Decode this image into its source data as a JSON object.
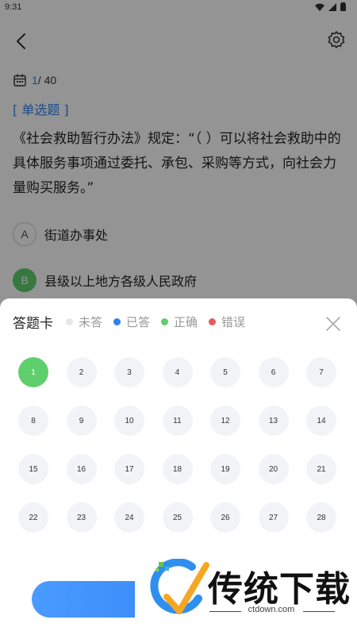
{
  "status_bar": {
    "time": "9:31"
  },
  "progress": {
    "current": "1",
    "total": "/ 40"
  },
  "question": {
    "type": "[ 单选题 ]",
    "text": "《社会救助暂行办法》规定：“（ ）可以将社会救助中的具体服务事项通过委托、承包、采购等方式，向社会力量购买服务。”",
    "options": [
      {
        "letter": "A",
        "text": "街道办事处"
      },
      {
        "letter": "B",
        "text": "县级以上地方各级人民政府",
        "selected": true
      }
    ]
  },
  "answer_sheet": {
    "title": "答题卡",
    "legend": [
      {
        "label": "未答",
        "color": "#e6e6e6"
      },
      {
        "label": "已答",
        "color": "#2f80ed"
      },
      {
        "label": "正确",
        "color": "#5fcf6b"
      },
      {
        "label": "错误",
        "color": "#e85a5a"
      }
    ],
    "numbers": [
      "1",
      "2",
      "3",
      "4",
      "5",
      "6",
      "7",
      "8",
      "9",
      "10",
      "11",
      "12",
      "13",
      "14",
      "15",
      "16",
      "17",
      "18",
      "19",
      "20",
      "21",
      "22",
      "23",
      "24",
      "25",
      "26",
      "27",
      "28"
    ],
    "correct": [
      "1"
    ]
  },
  "watermark": {
    "brand": "传统下载",
    "url": "ctdown.com"
  },
  "icons": {
    "back": "back-arrow-icon",
    "settings": "gear-icon",
    "calendar": "calendar-icon",
    "close": "close-icon"
  },
  "colors": {
    "accent": "#2f80ed",
    "correct": "#5fcf6b",
    "wrong": "#e85a5a"
  }
}
